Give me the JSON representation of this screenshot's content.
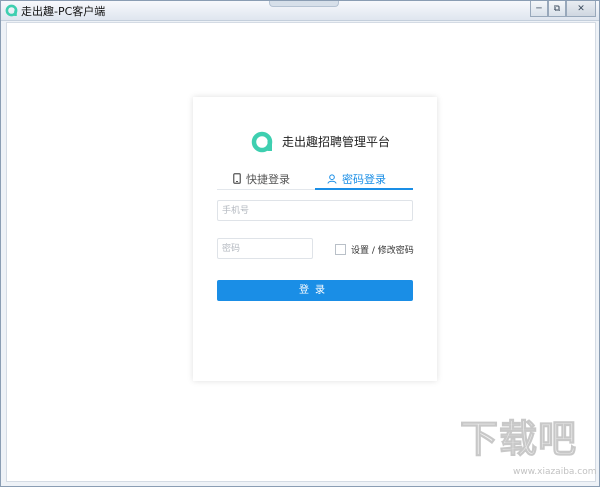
{
  "window": {
    "title": "走出趣-PC客户端",
    "icon": "app-logo-icon",
    "controls": {
      "minimize": "─",
      "restore": "⧉",
      "close": "✕"
    }
  },
  "card": {
    "brand_title": "走出趣招聘管理平台",
    "logo_color": "#3ecfb0",
    "tabs": [
      {
        "label": "快捷登录",
        "icon": "phone-icon",
        "active": false
      },
      {
        "label": "密码登录",
        "icon": "user-icon",
        "active": true
      }
    ],
    "phone_placeholder": "手机号",
    "password_placeholder": "密码",
    "remember_label": "设置 / 修改密码",
    "login_label": "登录"
  },
  "watermark": {
    "text": "下载吧",
    "sub": "www.xiazaiba.com"
  },
  "colors": {
    "accent": "#1a8ee6",
    "brand": "#3ecfb0"
  }
}
